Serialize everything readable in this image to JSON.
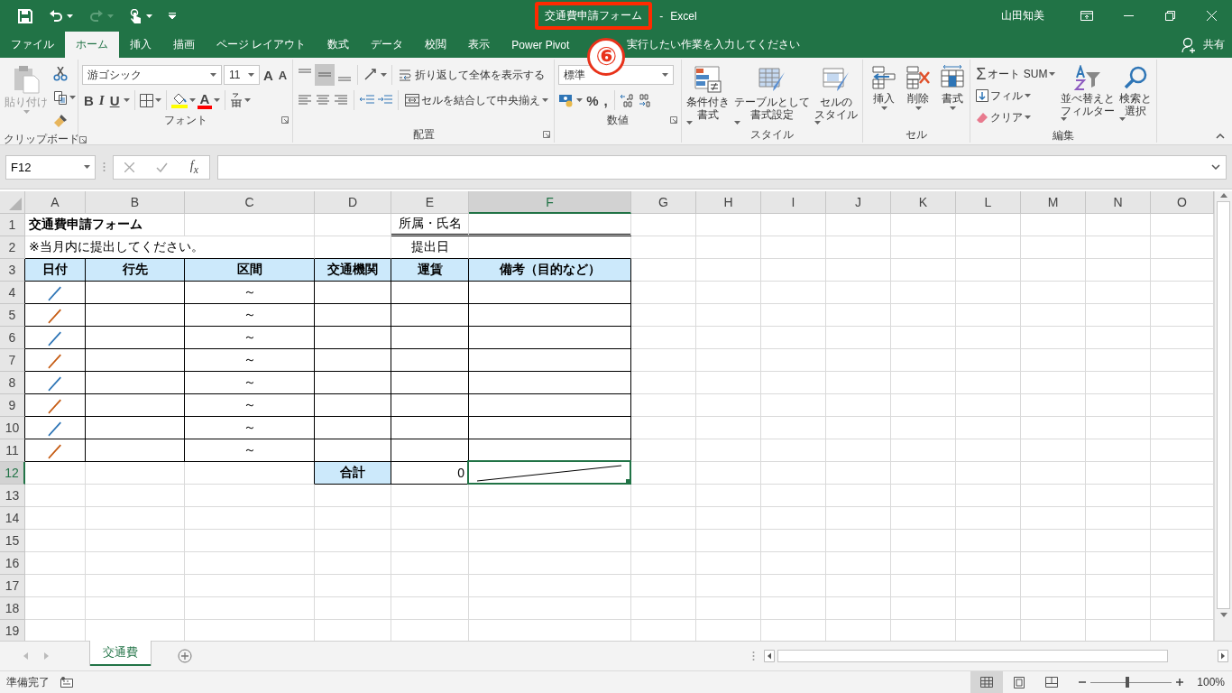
{
  "window": {
    "title": "交通費申請フォーム",
    "title_highlighted": true,
    "separator": "-",
    "app": "Excel",
    "user": "山田知美",
    "annotation": "⑥"
  },
  "tabs": [
    {
      "label": "ファイル",
      "selected": false
    },
    {
      "label": "ホーム",
      "selected": true
    },
    {
      "label": "挿入",
      "selected": false
    },
    {
      "label": "描画",
      "selected": false
    },
    {
      "label": "ページ レイアウト",
      "selected": false
    },
    {
      "label": "数式",
      "selected": false
    },
    {
      "label": "データ",
      "selected": false
    },
    {
      "label": "校閲",
      "selected": false
    },
    {
      "label": "表示",
      "selected": false
    },
    {
      "label": "Power Pivot",
      "selected": false
    }
  ],
  "tell_me": {
    "placeholder": "実行したい作業を入力してください"
  },
  "share": "共有",
  "ribbon": {
    "clipboard": {
      "paste": "貼り付け",
      "label": "クリップボード"
    },
    "font": {
      "font_name": "游ゴシック",
      "font_size": "11",
      "grow_font": "A",
      "shrink_font": "A",
      "bold": "B",
      "italic": "I",
      "underline": "U",
      "font_color": "A",
      "label": "フォント"
    },
    "alignment": {
      "wrap_text": "折り返して全体を表示する",
      "merge_center": "セルを結合して中央揃え",
      "label": "配置"
    },
    "number": {
      "format": "標準",
      "percent": "%",
      "comma": ",",
      "label": "数値"
    },
    "styles": {
      "buttons": [
        {
          "lines": [
            "条件付き",
            "書式"
          ]
        },
        {
          "lines": [
            "テーブルとして",
            "書式設定"
          ]
        },
        {
          "lines": [
            "セルの",
            "スタイル"
          ]
        }
      ],
      "label": "スタイル"
    },
    "cells": {
      "buttons": [
        "挿入",
        "削除",
        "書式"
      ],
      "label": "セル"
    },
    "editing": {
      "sum_symbol": "Σ",
      "autosum": "オート SUM",
      "fill": "フィル",
      "clear": "クリア",
      "buttons": [
        {
          "lines": [
            "並べ替えと",
            "フィルター"
          ]
        },
        {
          "lines": [
            "検索と",
            "選択"
          ]
        }
      ],
      "label": "編集"
    }
  },
  "formula_bar": {
    "name_box": "F12",
    "function_label": "f$_{x}$"
  },
  "sheet": {
    "columns": [
      {
        "label": "A",
        "selected": false
      },
      {
        "label": "B",
        "selected": false
      },
      {
        "label": "C",
        "selected": false
      },
      {
        "label": "D",
        "selected": false
      },
      {
        "label": "E",
        "selected": false
      },
      {
        "label": "F",
        "selected": true
      },
      {
        "label": "G",
        "selected": false
      },
      {
        "label": "H",
        "selected": false
      },
      {
        "label": "I",
        "selected": false
      },
      {
        "label": "J",
        "selected": false
      },
      {
        "label": "K",
        "selected": false
      },
      {
        "label": "L",
        "selected": false
      },
      {
        "label": "M",
        "selected": false
      },
      {
        "label": "N",
        "selected": false
      },
      {
        "label": "O",
        "selected": false
      }
    ],
    "rows": [
      {
        "number": "1",
        "selected": false,
        "kind": "title",
        "a": "交通費申請フォーム",
        "e": "所属・氏名"
      },
      {
        "number": "2",
        "selected": false,
        "kind": "note",
        "a": "※当月内に提出してください。",
        "e": "提出日"
      },
      {
        "number": "3",
        "selected": false,
        "kind": "header",
        "a": "日付",
        "b": "行先",
        "c": "区間",
        "d": "交通機関",
        "e": "運賃",
        "f": "備考（目的など）"
      },
      {
        "number": "4",
        "selected": false,
        "kind": "entry",
        "a": "／",
        "color": "#2e75b6",
        "c": "～"
      },
      {
        "number": "5",
        "selected": false,
        "kind": "entry",
        "a": "／",
        "color": "#c55a11",
        "c": "～"
      },
      {
        "number": "6",
        "selected": false,
        "kind": "entry",
        "a": "／",
        "color": "#2e75b6",
        "c": "～"
      },
      {
        "number": "7",
        "selected": false,
        "kind": "entry",
        "a": "／",
        "color": "#c55a11",
        "c": "～"
      },
      {
        "number": "8",
        "selected": false,
        "kind": "entry",
        "a": "／",
        "color": "#2e75b6",
        "c": "～"
      },
      {
        "number": "9",
        "selected": false,
        "kind": "entry",
        "a": "／",
        "color": "#c55a11",
        "c": "～"
      },
      {
        "number": "10",
        "selected": false,
        "kind": "entry",
        "a": "／",
        "color": "#2e75b6",
        "c": "～"
      },
      {
        "number": "11",
        "selected": false,
        "kind": "entry",
        "a": "／",
        "color": "#c55a11",
        "c": "～"
      },
      {
        "number": "12",
        "selected": true,
        "kind": "total",
        "d": "合計",
        "e": "0"
      },
      {
        "number": "13",
        "selected": false,
        "kind": "blank"
      },
      {
        "number": "14",
        "selected": false,
        "kind": "blank"
      },
      {
        "number": "15",
        "selected": false,
        "kind": "blank"
      },
      {
        "number": "16",
        "selected": false,
        "kind": "blank"
      },
      {
        "number": "17",
        "selected": false,
        "kind": "blank"
      },
      {
        "number": "18",
        "selected": false,
        "kind": "blank"
      },
      {
        "number": "19",
        "selected": false,
        "kind": "blank"
      }
    ],
    "tabs": [
      {
        "label": "交通費",
        "selected": true
      }
    ]
  },
  "status_bar": {
    "status": "準備完了",
    "views": [
      {
        "kind": "normal",
        "selected": true
      },
      {
        "kind": "page_layout",
        "selected": false
      },
      {
        "kind": "page_break",
        "selected": false
      }
    ],
    "zoom": {
      "level": 0.45,
      "reading": "100%"
    }
  }
}
